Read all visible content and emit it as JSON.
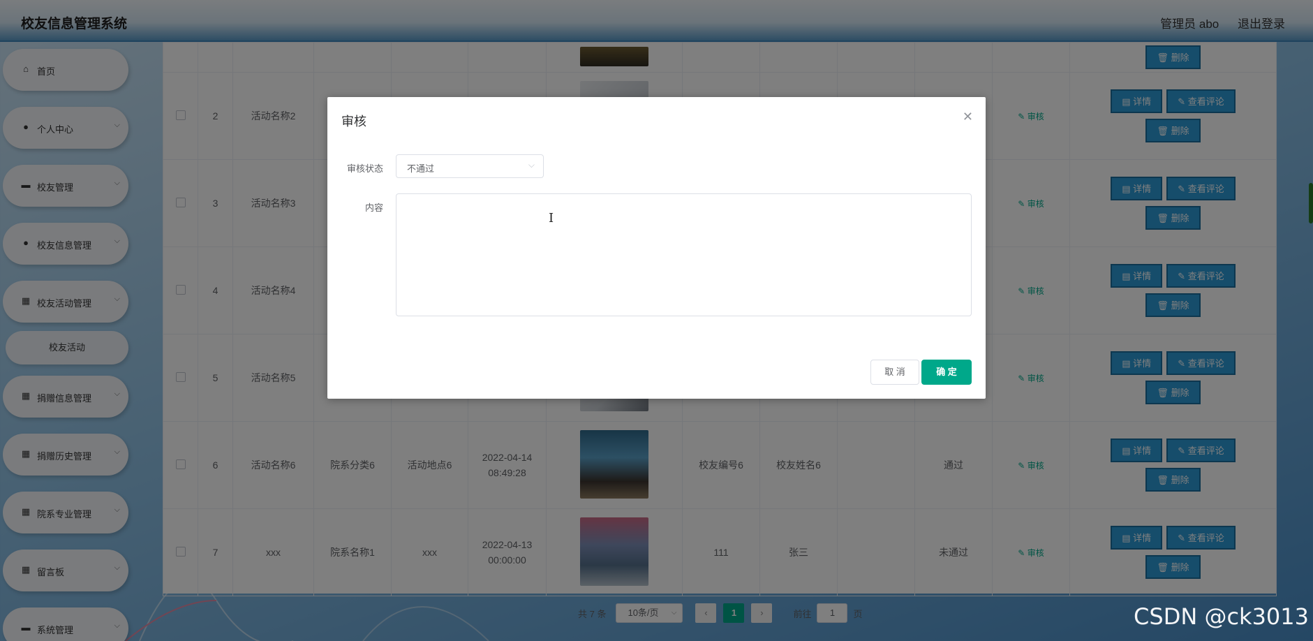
{
  "header": {
    "title": "校友信息管理系统",
    "user": "管理员 abo",
    "logout": "退出登录"
  },
  "sidebar": {
    "items": [
      {
        "label": "首页",
        "icon": "home-icon",
        "glyph": "⌂",
        "chevron": false
      },
      {
        "label": "个人中心",
        "icon": "user-icon",
        "glyph": "●",
        "chevron": true
      },
      {
        "label": "校友管理",
        "icon": "briefcase-icon",
        "glyph": "▬",
        "chevron": true
      },
      {
        "label": "校友信息管理",
        "icon": "pin-icon",
        "glyph": "●",
        "chevron": true
      },
      {
        "label": "校友活动管理",
        "icon": "grid-icon",
        "glyph": "▦",
        "chevron": true
      },
      {
        "label": "捐赠信息管理",
        "icon": "grid-icon",
        "glyph": "▦",
        "chevron": true
      },
      {
        "label": "捐赠历史管理",
        "icon": "grid-icon",
        "glyph": "▦",
        "chevron": true
      },
      {
        "label": "院系专业管理",
        "icon": "grid-icon",
        "glyph": "▦",
        "chevron": true
      },
      {
        "label": "留言板",
        "icon": "grid-icon",
        "glyph": "▦",
        "chevron": true
      },
      {
        "label": "系统管理",
        "icon": "chat-icon",
        "glyph": "▬",
        "chevron": true
      }
    ],
    "submenu_label": "校友活动"
  },
  "table": {
    "rows": [
      {
        "no": "2",
        "name": "活动名称2",
        "dept": "",
        "place": "",
        "time": "",
        "alumni_no": "",
        "alumni_name": "",
        "status": ""
      },
      {
        "no": "3",
        "name": "活动名称3",
        "dept": "",
        "place": "",
        "time": "",
        "alumni_no": "",
        "alumni_name": "",
        "status": ""
      },
      {
        "no": "4",
        "name": "活动名称4",
        "dept": "",
        "place": "",
        "time": "",
        "alumni_no": "",
        "alumni_name": "",
        "status": ""
      },
      {
        "no": "5",
        "name": "活动名称5",
        "dept": "",
        "place": "",
        "time": "",
        "alumni_no": "",
        "alumni_name": "",
        "status": ""
      },
      {
        "no": "6",
        "name": "活动名称6",
        "dept": "院系分类6",
        "place": "活动地点6",
        "time": "2022-04-14 08:49:28",
        "alumni_no": "校友编号6",
        "alumni_name": "校友姓名6",
        "status": "通过"
      },
      {
        "no": "7",
        "name": "xxx",
        "dept": "院系名称1",
        "place": "xxx",
        "time": "2022-04-13 00:00:00",
        "alumni_no": "111",
        "alumni_name": "张三",
        "status": "未通过"
      }
    ],
    "audit_label": "审核",
    "detail_label": "详情",
    "comment_label": "查看评论",
    "delete_label": "删除"
  },
  "pagination": {
    "total": "共 7 条",
    "page_size": "10条/页",
    "current": "1",
    "goto_prefix": "前往",
    "goto_value": "1",
    "goto_suffix": "页"
  },
  "dialog": {
    "title": "审核",
    "status_label": "审核状态",
    "status_value": "不通过",
    "content_label": "内容",
    "content_value": "",
    "cancel": "取 消",
    "confirm": "确 定"
  },
  "watermark": "CSDN @ck3013",
  "colors": {
    "accent": "#00a88a",
    "action_blue": "#2c9ad6",
    "header_blue": "#3f86bc"
  }
}
